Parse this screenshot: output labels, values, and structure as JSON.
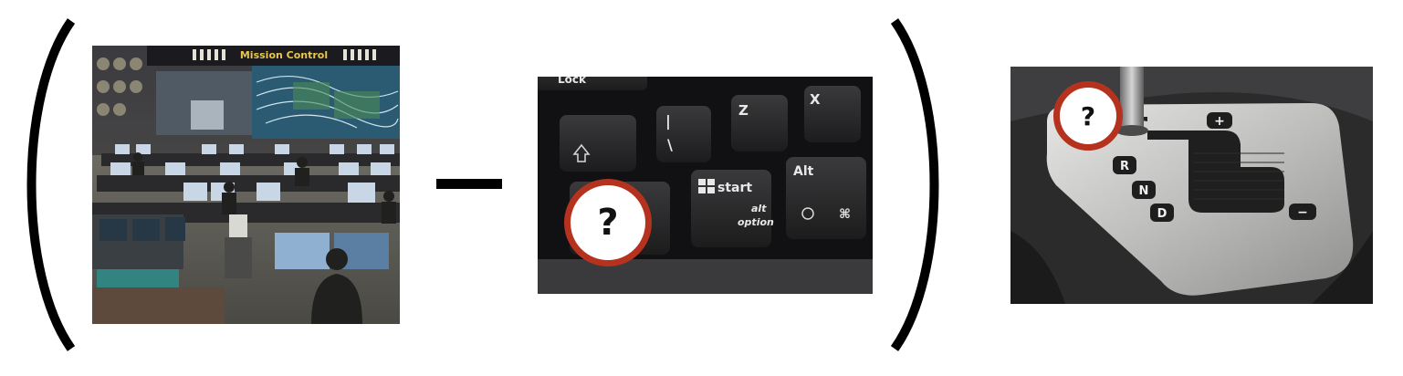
{
  "puzzle": {
    "operator": "minus",
    "left_paren": "(",
    "right_paren": ")",
    "marker_text": "?"
  },
  "photo_control_room": {
    "subject": "mission control room",
    "sign_text": "Mission Control"
  },
  "photo_keyboard": {
    "subject": "keyboard keys",
    "keys": {
      "lock": "Lock",
      "z": "Z",
      "x": "X",
      "backslash": "\\",
      "backslash_shift": "|",
      "start": "start",
      "start_sub1": "alt",
      "start_sub2": "option",
      "alt": "Alt",
      "cmd": "⌘"
    }
  },
  "photo_shifter": {
    "subject": "automatic gear shifter",
    "gears": {
      "r": "R",
      "n": "N",
      "d": "D",
      "plus": "+",
      "minus": "−"
    }
  },
  "colors": {
    "marker_border": "#b5321f"
  }
}
